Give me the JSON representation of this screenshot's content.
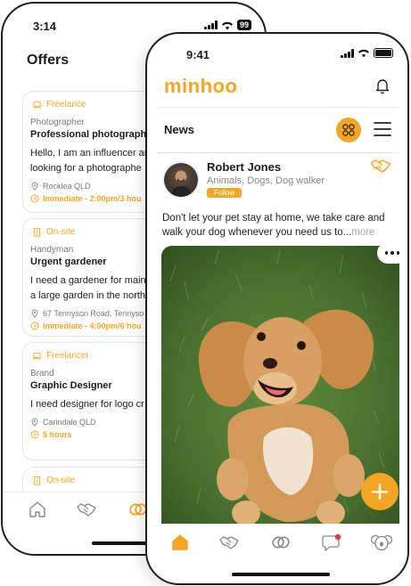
{
  "back_phone": {
    "status": {
      "time": "3:14",
      "battery": "99"
    },
    "title": "Offers",
    "offers": [
      {
        "type": "Freelance",
        "category": "Photographer",
        "title": "Professional photographe",
        "description": [
          "Hello, I am an influencer ar",
          "looking for a photographe"
        ],
        "location": "Rocklea QLD",
        "time": "Immediate - 2:00pm/3 hou"
      },
      {
        "type": "On-site",
        "category": "Handyman",
        "title": "Urgent gardener",
        "description": [
          "I need a gardener for main",
          "a large garden in the north"
        ],
        "location": "67 Tennyson Road, Tennyso",
        "time": "Immediate - 4:00pm/6 hou"
      },
      {
        "type": "Freelancer",
        "category": "Brand",
        "title": "Graphic Designer",
        "description": [
          "I need designer for logo cr"
        ],
        "location": "Carindale QLD",
        "time": "5 hours"
      },
      {
        "type": "On-site"
      }
    ],
    "nav": [
      "home-icon",
      "handshake-icon",
      "link-icon"
    ]
  },
  "front_phone": {
    "status": {
      "time": "9:41"
    },
    "logo": "minhoo",
    "section_title": "News",
    "post": {
      "author": "Robert Jones",
      "tags": "Animals, Dogs, Dog walker",
      "follow_label": "Follow",
      "text": "Don't let your pet stay at home, we take care and walk your dog whenever you need us to...",
      "more_label": "more"
    },
    "fab_label": "+",
    "nav": [
      "home-icon",
      "handshake-icon",
      "link-icon",
      "chat-icon",
      "koala-icon"
    ]
  },
  "colors": {
    "accent": "#f5a524",
    "text": "#1c1c1c",
    "muted": "#888888",
    "notification": "#e53935"
  }
}
